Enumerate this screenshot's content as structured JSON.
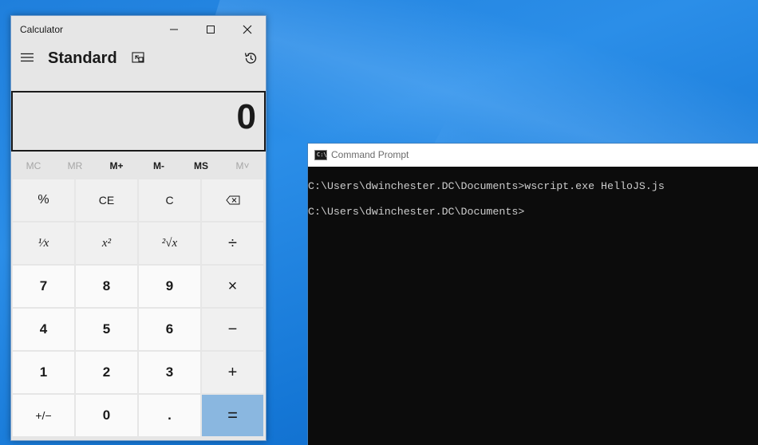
{
  "calculator": {
    "window_title": "Calculator",
    "mode": "Standard",
    "display": "0",
    "memory": [
      {
        "label": "MC",
        "enabled": false
      },
      {
        "label": "MR",
        "enabled": false
      },
      {
        "label": "M+",
        "enabled": true
      },
      {
        "label": "M-",
        "enabled": true
      },
      {
        "label": "MS",
        "enabled": true
      },
      {
        "label": "M˅",
        "enabled": false
      }
    ],
    "keys": {
      "percent": "%",
      "ce": "CE",
      "c": "C",
      "backspace": "⌫",
      "reciprocal": "¹⁄x",
      "square": "x²",
      "sqrt": "²√x",
      "divide": "÷",
      "seven": "7",
      "eight": "8",
      "nine": "9",
      "multiply": "×",
      "four": "4",
      "five": "5",
      "six": "6",
      "minus": "−",
      "one": "1",
      "two": "2",
      "three": "3",
      "plus": "+",
      "negate": "+/−",
      "zero": "0",
      "decimal": ".",
      "equals": "="
    },
    "colors": {
      "equals_key": "#8ab7e0",
      "background": "#e6e6e6"
    }
  },
  "command_prompt": {
    "window_title": "Command Prompt",
    "lines": [
      "C:\\Users\\dwinchester.DC\\Documents>wscript.exe HelloJS.js",
      "",
      "C:\\Users\\dwinchester.DC\\Documents>"
    ]
  }
}
